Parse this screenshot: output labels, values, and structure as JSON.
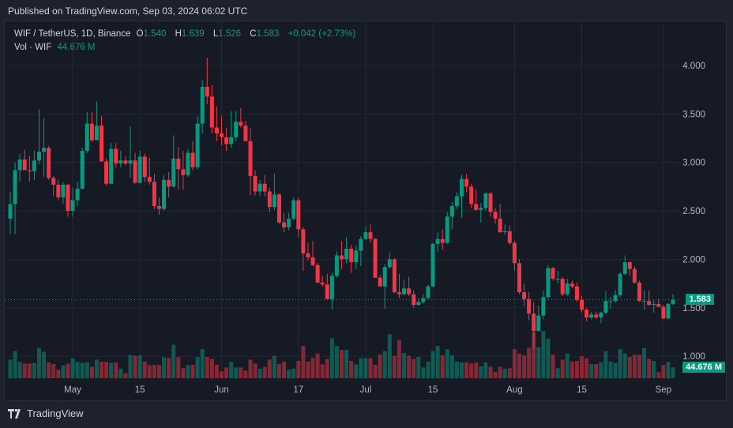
{
  "header": {
    "published": "Published on TradingView.com, Sep 03, 2024 06:02 UTC"
  },
  "legend": {
    "symbol": "WIF / TetherUS, 1D, Binance",
    "o_label": "O",
    "o": "1.540",
    "h_label": "H",
    "h": "1.639",
    "l_label": "L",
    "l": "1.526",
    "c_label": "C",
    "c": "1.583",
    "change": "+0.042 (+2.73%)",
    "vol_label": "Vol · WIF",
    "vol": "44.676 M"
  },
  "footer": {
    "brand": "TradingView"
  },
  "colors": {
    "up": "#089981",
    "down": "#f23645",
    "background": "#161a25",
    "grid": "#232733"
  },
  "chart_data": {
    "type": "candlestick",
    "title": "WIF / TetherUS, 1D, Binance",
    "last_price_label": "1.583",
    "last_volume_label": "44.676 M",
    "ylim": [
      0.75,
      4.3
    ],
    "y_ticks": [
      {
        "v": 4.0,
        "label": "4.000"
      },
      {
        "v": 3.5,
        "label": "3.500"
      },
      {
        "v": 3.0,
        "label": "3.000"
      },
      {
        "v": 2.5,
        "label": "2.500"
      },
      {
        "v": 2.0,
        "label": "2.000"
      },
      {
        "v": 1.5,
        "label": "1.500"
      },
      {
        "v": 1.0,
        "label": "1.000"
      }
    ],
    "x_ticks": [
      {
        "i": 13,
        "label": "May"
      },
      {
        "i": 27,
        "label": "15"
      },
      {
        "i": 44,
        "label": "Jun"
      },
      {
        "i": 60,
        "label": "17"
      },
      {
        "i": 74,
        "label": "Jul"
      },
      {
        "i": 88,
        "label": "15"
      },
      {
        "i": 105,
        "label": "Aug"
      },
      {
        "i": 119,
        "label": "15"
      },
      {
        "i": 136,
        "label": "Sep"
      }
    ],
    "ohlc": [
      [
        2.42,
        2.7,
        2.26,
        2.57
      ],
      [
        2.57,
        3.0,
        2.26,
        2.92
      ],
      [
        2.92,
        3.09,
        2.8,
        3.03
      ],
      [
        3.03,
        3.13,
        2.95,
        2.92
      ],
      [
        2.92,
        3.07,
        2.8,
        2.91
      ],
      [
        2.91,
        3.12,
        2.82,
        3.02
      ],
      [
        3.02,
        3.55,
        2.98,
        3.11
      ],
      [
        3.11,
        3.46,
        2.85,
        3.15
      ],
      [
        3.15,
        3.17,
        2.82,
        2.84
      ],
      [
        2.84,
        2.86,
        2.65,
        2.77
      ],
      [
        2.77,
        2.82,
        2.61,
        2.64
      ],
      [
        2.64,
        2.8,
        2.57,
        2.77
      ],
      [
        2.77,
        2.78,
        2.44,
        2.5
      ],
      [
        2.5,
        2.74,
        2.44,
        2.61
      ],
      [
        2.61,
        2.8,
        2.55,
        2.73
      ],
      [
        2.73,
        3.15,
        2.72,
        3.12
      ],
      [
        3.12,
        3.52,
        3.1,
        3.4
      ],
      [
        3.4,
        3.52,
        3.21,
        3.23
      ],
      [
        3.23,
        3.63,
        3.23,
        3.38
      ],
      [
        3.38,
        3.48,
        3.01,
        3.01
      ],
      [
        3.01,
        3.04,
        2.76,
        2.78
      ],
      [
        2.78,
        3.2,
        2.78,
        3.14
      ],
      [
        3.14,
        3.2,
        2.95,
        2.99
      ],
      [
        2.99,
        3.12,
        2.95,
        3.02
      ],
      [
        3.02,
        3.06,
        2.97,
        2.99
      ],
      [
        2.99,
        3.37,
        2.84,
        3.02
      ],
      [
        3.02,
        3.1,
        2.78,
        2.79
      ],
      [
        2.79,
        3.12,
        2.78,
        3.06
      ],
      [
        3.06,
        3.09,
        2.8,
        2.85
      ],
      [
        2.85,
        3.05,
        2.77,
        2.8
      ],
      [
        2.8,
        2.88,
        2.52,
        2.55
      ],
      [
        2.55,
        2.64,
        2.46,
        2.52
      ],
      [
        2.52,
        2.87,
        2.5,
        2.82
      ],
      [
        2.82,
        2.9,
        2.64,
        2.75
      ],
      [
        2.75,
        3.28,
        2.74,
        3.04
      ],
      [
        3.04,
        3.16,
        2.72,
        2.93
      ],
      [
        2.93,
        3.12,
        2.72,
        2.87
      ],
      [
        2.87,
        3.14,
        2.85,
        3.1
      ],
      [
        3.1,
        3.22,
        2.92,
        2.95
      ],
      [
        2.95,
        3.48,
        2.93,
        3.4
      ],
      [
        3.4,
        3.85,
        3.3,
        3.78
      ],
      [
        3.78,
        4.08,
        3.6,
        3.68
      ],
      [
        3.68,
        3.8,
        3.3,
        3.36
      ],
      [
        3.36,
        3.58,
        3.22,
        3.3
      ],
      [
        3.3,
        3.48,
        3.18,
        3.26
      ],
      [
        3.26,
        3.36,
        3.12,
        3.19
      ],
      [
        3.19,
        3.53,
        3.15,
        3.26
      ],
      [
        3.26,
        3.53,
        3.22,
        3.42
      ],
      [
        3.42,
        3.56,
        3.36,
        3.38
      ],
      [
        3.38,
        3.43,
        3.22,
        3.22
      ],
      [
        3.22,
        3.35,
        2.66,
        2.86
      ],
      [
        2.86,
        2.92,
        2.66,
        2.7
      ],
      [
        2.7,
        2.82,
        2.65,
        2.78
      ],
      [
        2.78,
        2.87,
        2.65,
        2.7
      ],
      [
        2.7,
        2.74,
        2.49,
        2.54
      ],
      [
        2.54,
        2.88,
        2.51,
        2.67
      ],
      [
        2.67,
        2.68,
        2.37,
        2.38
      ],
      [
        2.38,
        2.48,
        2.28,
        2.33
      ],
      [
        2.33,
        2.48,
        2.3,
        2.42
      ],
      [
        2.42,
        2.64,
        2.4,
        2.61
      ],
      [
        2.61,
        2.64,
        2.23,
        2.31
      ],
      [
        2.31,
        2.33,
        1.88,
        2.06
      ],
      [
        2.06,
        2.17,
        1.99,
        2.02
      ],
      [
        2.02,
        2.19,
        1.93,
        1.94
      ],
      [
        1.94,
        1.96,
        1.75,
        1.76
      ],
      [
        1.76,
        1.83,
        1.72,
        1.74
      ],
      [
        1.74,
        1.85,
        1.59,
        1.59
      ],
      [
        1.59,
        1.86,
        1.48,
        1.83
      ],
      [
        1.83,
        2.08,
        1.81,
        2.04
      ],
      [
        2.04,
        2.19,
        1.9,
        2.0
      ],
      [
        2.0,
        2.23,
        1.96,
        2.11
      ],
      [
        2.11,
        2.15,
        1.86,
        1.97
      ],
      [
        1.97,
        2.14,
        1.9,
        2.09
      ],
      [
        2.09,
        2.24,
        1.93,
        2.21
      ],
      [
        2.21,
        2.34,
        2.2,
        2.28
      ],
      [
        2.28,
        2.36,
        2.17,
        2.21
      ],
      [
        2.21,
        2.22,
        1.81,
        1.81
      ],
      [
        1.81,
        1.84,
        1.72,
        1.72
      ],
      [
        1.72,
        1.95,
        1.49,
        1.92
      ],
      [
        1.92,
        2.07,
        1.9,
        2.0
      ],
      [
        2.0,
        2.01,
        1.65,
        1.66
      ],
      [
        1.66,
        1.85,
        1.6,
        1.64
      ],
      [
        1.64,
        1.79,
        1.63,
        1.7
      ],
      [
        1.7,
        1.82,
        1.62,
        1.64
      ],
      [
        1.64,
        1.68,
        1.5,
        1.53
      ],
      [
        1.53,
        1.6,
        1.52,
        1.56
      ],
      [
        1.56,
        1.64,
        1.54,
        1.6
      ],
      [
        1.6,
        1.74,
        1.59,
        1.72
      ],
      [
        1.72,
        2.17,
        1.71,
        2.16
      ],
      [
        2.16,
        2.28,
        2.08,
        2.21
      ],
      [
        2.21,
        2.31,
        2.1,
        2.17
      ],
      [
        2.17,
        2.49,
        2.16,
        2.44
      ],
      [
        2.44,
        2.59,
        2.31,
        2.55
      ],
      [
        2.55,
        2.69,
        2.52,
        2.65
      ],
      [
        2.65,
        2.87,
        2.43,
        2.83
      ],
      [
        2.83,
        2.88,
        2.69,
        2.75
      ],
      [
        2.75,
        2.78,
        2.53,
        2.57
      ],
      [
        2.57,
        2.72,
        2.5,
        2.51
      ],
      [
        2.51,
        2.58,
        2.38,
        2.53
      ],
      [
        2.53,
        2.69,
        2.5,
        2.68
      ],
      [
        2.68,
        2.7,
        2.44,
        2.49
      ],
      [
        2.49,
        2.53,
        2.37,
        2.42
      ],
      [
        2.42,
        2.57,
        2.27,
        2.28
      ],
      [
        2.28,
        2.36,
        2.25,
        2.29
      ],
      [
        2.29,
        2.35,
        2.15,
        2.17
      ],
      [
        2.17,
        2.19,
        1.88,
        1.96
      ],
      [
        1.96,
        2.0,
        1.64,
        1.66
      ],
      [
        1.66,
        1.75,
        1.52,
        1.59
      ],
      [
        1.59,
        1.66,
        1.37,
        1.44
      ],
      [
        1.44,
        1.56,
        1.07,
        1.26
      ],
      [
        1.26,
        1.52,
        1.26,
        1.42
      ],
      [
        1.42,
        1.68,
        1.38,
        1.61
      ],
      [
        1.61,
        1.94,
        1.59,
        1.91
      ],
      [
        1.91,
        1.92,
        1.78,
        1.8
      ],
      [
        1.8,
        1.88,
        1.75,
        1.8
      ],
      [
        1.8,
        1.82,
        1.62,
        1.64
      ],
      [
        1.64,
        1.8,
        1.62,
        1.75
      ],
      [
        1.75,
        1.78,
        1.7,
        1.72
      ],
      [
        1.72,
        1.76,
        1.56,
        1.58
      ],
      [
        1.58,
        1.62,
        1.45,
        1.48
      ],
      [
        1.48,
        1.5,
        1.36,
        1.4
      ],
      [
        1.4,
        1.46,
        1.38,
        1.43
      ],
      [
        1.43,
        1.46,
        1.38,
        1.4
      ],
      [
        1.4,
        1.46,
        1.34,
        1.45
      ],
      [
        1.45,
        1.67,
        1.43,
        1.57
      ],
      [
        1.57,
        1.61,
        1.49,
        1.57
      ],
      [
        1.57,
        1.68,
        1.55,
        1.63
      ],
      [
        1.63,
        1.87,
        1.61,
        1.85
      ],
      [
        1.85,
        2.04,
        1.84,
        1.97
      ],
      [
        1.97,
        1.98,
        1.83,
        1.9
      ],
      [
        1.9,
        1.93,
        1.75,
        1.76
      ],
      [
        1.76,
        1.78,
        1.56,
        1.57
      ],
      [
        1.57,
        1.68,
        1.48,
        1.57
      ],
      [
        1.57,
        1.68,
        1.52,
        1.53
      ],
      [
        1.53,
        1.58,
        1.45,
        1.54
      ],
      [
        1.54,
        1.59,
        1.51,
        1.51
      ],
      [
        1.51,
        1.53,
        1.38,
        1.39
      ],
      [
        1.39,
        1.55,
        1.38,
        1.54
      ],
      [
        1.54,
        1.639,
        1.526,
        1.583
      ]
    ],
    "volume_millions": [
      76,
      111,
      66,
      60,
      60,
      62,
      124,
      108,
      65,
      58,
      35,
      52,
      60,
      81,
      67,
      63,
      65,
      47,
      76,
      68,
      67,
      63,
      65,
      39,
      21,
      95,
      92,
      94,
      68,
      54,
      54,
      54,
      86,
      83,
      137,
      86,
      41,
      54,
      55,
      87,
      119,
      87,
      79,
      55,
      28,
      44,
      67,
      44,
      44,
      31,
      76,
      60,
      39,
      46,
      76,
      92,
      58,
      68,
      35,
      39,
      71,
      132,
      68,
      83,
      101,
      57,
      78,
      163,
      132,
      116,
      116,
      71,
      57,
      82,
      82,
      82,
      55,
      97,
      111,
      180,
      92,
      156,
      103,
      92,
      79,
      87,
      44,
      68,
      111,
      132,
      94,
      119,
      94,
      68,
      65,
      65,
      60,
      65,
      49,
      65,
      47,
      26,
      47,
      39,
      41,
      119,
      101,
      94,
      124,
      188,
      127,
      193,
      162,
      96,
      41,
      76,
      101,
      68,
      71,
      90,
      81,
      58,
      58,
      65,
      111,
      68,
      62,
      119,
      101,
      87,
      96,
      96,
      124,
      79,
      71,
      25,
      54,
      67,
      44.676
    ]
  }
}
